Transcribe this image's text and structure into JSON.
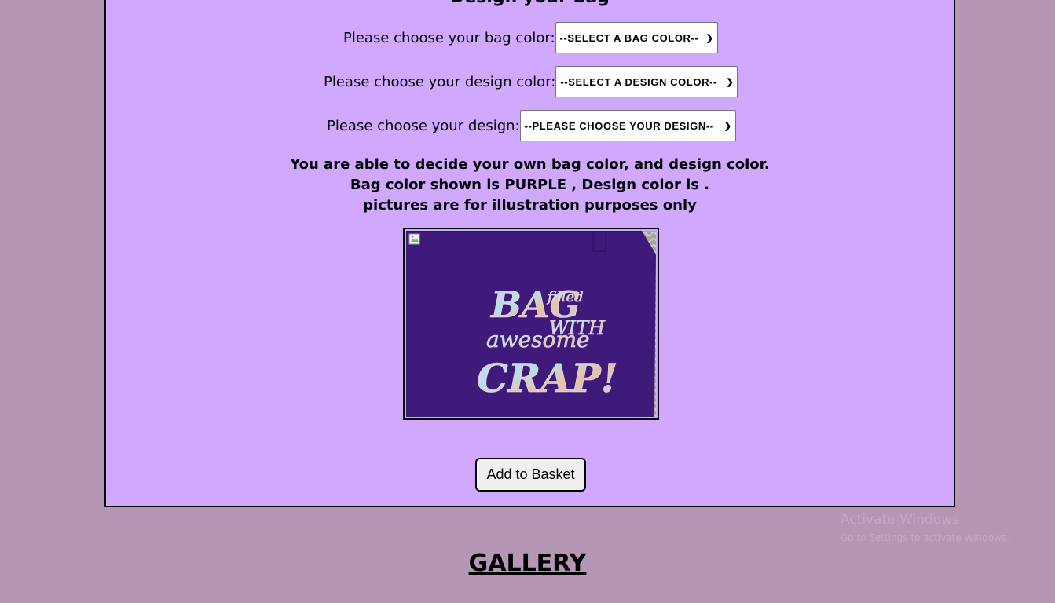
{
  "design_section": {
    "title": "Design your bag",
    "bag_color": {
      "label": "Please choose your bag color:",
      "selected": "--SELECT A BAG COLOR--"
    },
    "design_color": {
      "label": "Please choose your design color:",
      "selected": "--SELECT A DESIGN COLOR--"
    },
    "design": {
      "label": "Please choose your design:",
      "selected": "--PLEASE CHOOSE YOUR DESIGN--"
    },
    "info_lines": [
      "You are able to decide your own bag color, and design color.",
      "Bag color shown is PURPLE , Design color is .",
      "pictures are for illustration purposes only"
    ],
    "product_image": {
      "lettering": [
        "BAG",
        "filled",
        "WITH",
        "awesome",
        "CRAP!"
      ]
    },
    "add_button_label": "Add to Basket"
  },
  "gallery": {
    "title": "GALLERY"
  },
  "os_watermark": {
    "line1": "Activate Windows",
    "line2": "Go to Settings to activate Windows."
  },
  "colors": {
    "page_bg": "#b596b5",
    "panel_bg": "#d0a8fd",
    "bag_purple": "#3f1a7a"
  }
}
